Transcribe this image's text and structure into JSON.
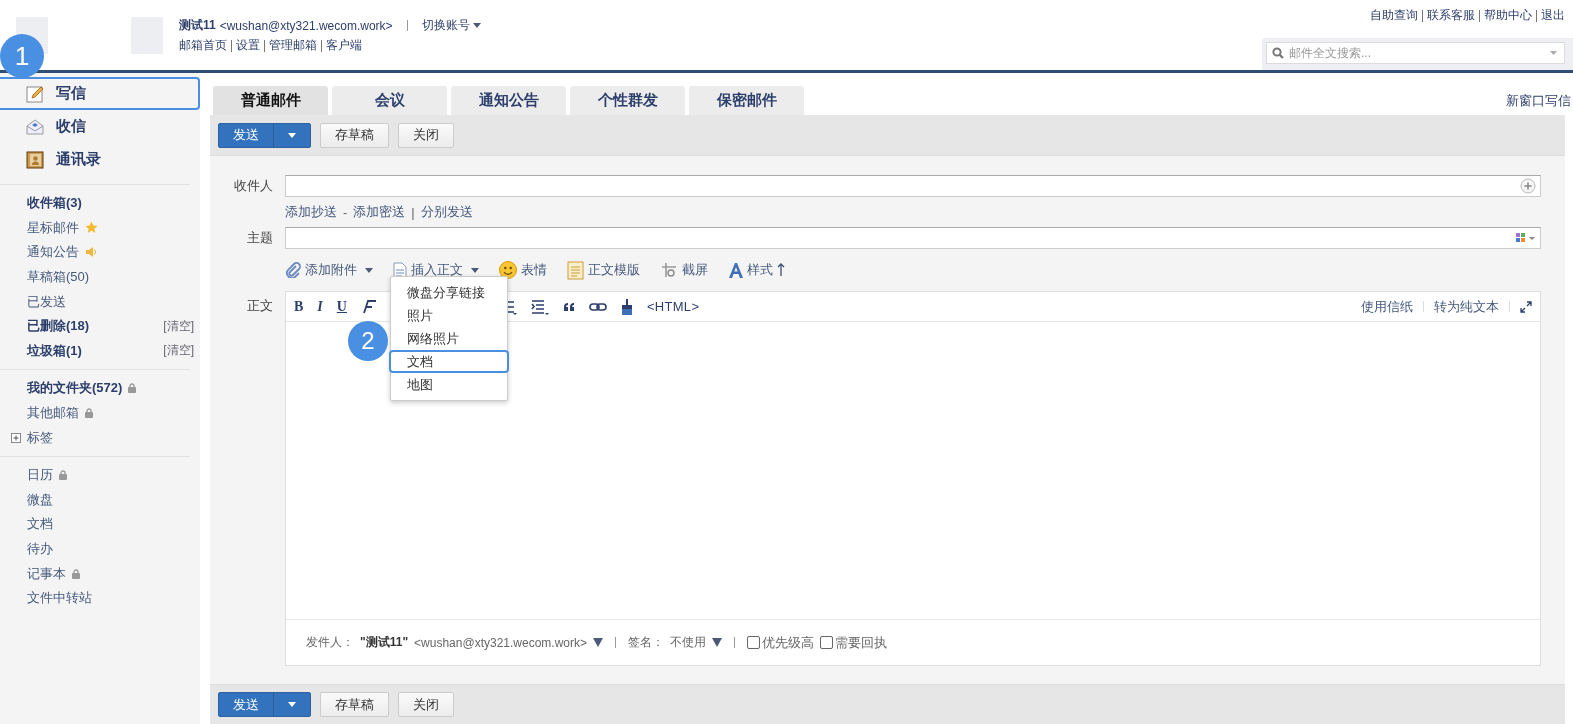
{
  "header": {
    "account_name": "测试11",
    "account_email": "<wushan@xty321.wecom.work>",
    "switch_account": "切换账号",
    "nav_links": [
      "邮箱首页",
      "设置",
      "管理邮箱",
      "客户端"
    ],
    "top_links": [
      "自助查询",
      "联系客服",
      "帮助中心",
      "退出"
    ],
    "search": {
      "placeholder": "邮件全文搜索..."
    }
  },
  "sidebar": {
    "main_items": [
      {
        "label": "写信",
        "kind": "compose",
        "selected": true
      },
      {
        "label": "收信",
        "kind": "inbox",
        "selected": false
      },
      {
        "label": "通讯录",
        "kind": "contacts",
        "selected": false
      }
    ],
    "folder_groups": [
      [
        {
          "label": "收件箱(3)",
          "bold": true
        },
        {
          "label": "星标邮件",
          "bold": false,
          "kind": "starred"
        },
        {
          "label": "通知公告",
          "bold": false,
          "kind": "announcement"
        },
        {
          "label": "草稿箱(50)",
          "bold": false
        },
        {
          "label": "已发送",
          "bold": false
        },
        {
          "label": "已删除(18)",
          "bold": true,
          "action": "[清空]"
        },
        {
          "label": "垃圾箱(1)",
          "bold": true,
          "action": "[清空]"
        }
      ],
      [
        {
          "label": "我的文件夹(572)",
          "bold": true,
          "kind": "locked"
        },
        {
          "label": "其他邮箱",
          "bold": false,
          "kind": "locked"
        },
        {
          "label": "标签",
          "bold": false,
          "kind": "expandable",
          "expanded": false
        }
      ],
      [
        {
          "label": "日历",
          "bold": false,
          "kind": "locked"
        },
        {
          "label": "微盘",
          "bold": false
        },
        {
          "label": "文档",
          "bold": false
        },
        {
          "label": "待办",
          "bold": false
        },
        {
          "label": "记事本",
          "bold": false,
          "kind": "locked"
        },
        {
          "label": "文件中转站",
          "bold": false
        }
      ]
    ]
  },
  "compose": {
    "tabs": [
      {
        "label": "普通邮件",
        "selected": true
      },
      {
        "label": "会议",
        "selected": false
      },
      {
        "label": "通知公告",
        "selected": false
      },
      {
        "label": "个性群发",
        "selected": false
      },
      {
        "label": "保密邮件",
        "selected": false
      }
    ],
    "new_window_link": "新窗口写信",
    "top_actions": {
      "send": "发送",
      "save_draft": "存草稿",
      "close": "关闭"
    },
    "to_label": "收件人",
    "recipient_links": [
      {
        "kind": "link",
        "text": "添加抄送"
      },
      {
        "kind": "separator",
        "text": "-"
      },
      {
        "kind": "link",
        "text": "添加密送"
      },
      {
        "kind": "separator",
        "text": "|"
      },
      {
        "kind": "link",
        "text": "分别发送"
      }
    ],
    "subject_label": "主题",
    "attach_tools": [
      {
        "kind": "attach",
        "label": "添加附件",
        "caret": true
      },
      {
        "kind": "insert",
        "label": "插入正文",
        "caret": true
      },
      {
        "kind": "emoji",
        "label": "表情",
        "caret": false
      },
      {
        "kind": "template",
        "label": "正文模版",
        "caret": false
      },
      {
        "kind": "screenshot",
        "label": "截屏",
        "caret": false
      },
      {
        "kind": "style",
        "label": "样式",
        "caret": false
      }
    ],
    "body_label": "正文",
    "editor_tools": [
      {
        "kind": "bold",
        "text": "B"
      },
      {
        "kind": "italic",
        "text": "I"
      },
      {
        "kind": "underline",
        "text": "U"
      },
      {
        "kind": "font"
      },
      {
        "kind": "gap"
      },
      {
        "kind": "list"
      },
      {
        "kind": "indent"
      },
      {
        "kind": "quote"
      },
      {
        "kind": "link"
      },
      {
        "kind": "brush"
      },
      {
        "kind": "html",
        "text": "<HTML>"
      }
    ],
    "editor_links": [
      "使用信纸",
      "转为纯文本"
    ],
    "sender_label": "发件人：",
    "sender_name": "\"测试11\"",
    "sender_email": "<wushan@xty321.wecom.work>",
    "signature_label": "签名：",
    "signature_value": "不使用",
    "options": [
      {
        "label": "优先级高",
        "checked": false
      },
      {
        "label": "需要回执",
        "checked": false
      }
    ],
    "bottom_actions": {
      "send": "发送",
      "save_draft": "存草稿",
      "close": "关闭"
    }
  },
  "insert_menu": {
    "items": [
      {
        "label": "微盘分享链接",
        "highlighted": false
      },
      {
        "label": "照片",
        "highlighted": false
      },
      {
        "label": "网络照片",
        "highlighted": false
      },
      {
        "label": "文档",
        "highlighted": true
      },
      {
        "label": "地图",
        "highlighted": false
      }
    ]
  },
  "callouts": [
    "1",
    "2"
  ]
}
